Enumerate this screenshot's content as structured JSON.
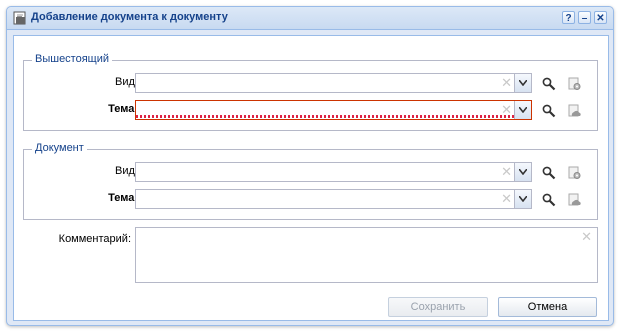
{
  "window": {
    "title": "Добавление документа к документу",
    "tools": {
      "help": "?",
      "minimize": "–",
      "close": "✕"
    }
  },
  "superior": {
    "legend": "Вышестоящий",
    "type_label": "Вид:",
    "type_value": "",
    "subject_label": "Тема:",
    "subject_value": "",
    "subject_invalid": true
  },
  "document": {
    "legend": "Документ",
    "type_label": "Вид:",
    "type_value": "",
    "subject_label": "Тема:",
    "subject_value": ""
  },
  "comment": {
    "label": "Комментарий:",
    "value": ""
  },
  "buttons": {
    "save": "Сохранить",
    "save_disabled": true,
    "cancel": "Отмена"
  },
  "icons": {
    "clear": "✕",
    "window": "document-icon",
    "search": "search-icon",
    "settings": "gear-icon",
    "cloud": "cloud-icon",
    "dropdown": "chevron-down-icon"
  },
  "colors": {
    "title_text": "#15428b",
    "frame": "#99bbe8",
    "invalid": "#cc3300"
  }
}
